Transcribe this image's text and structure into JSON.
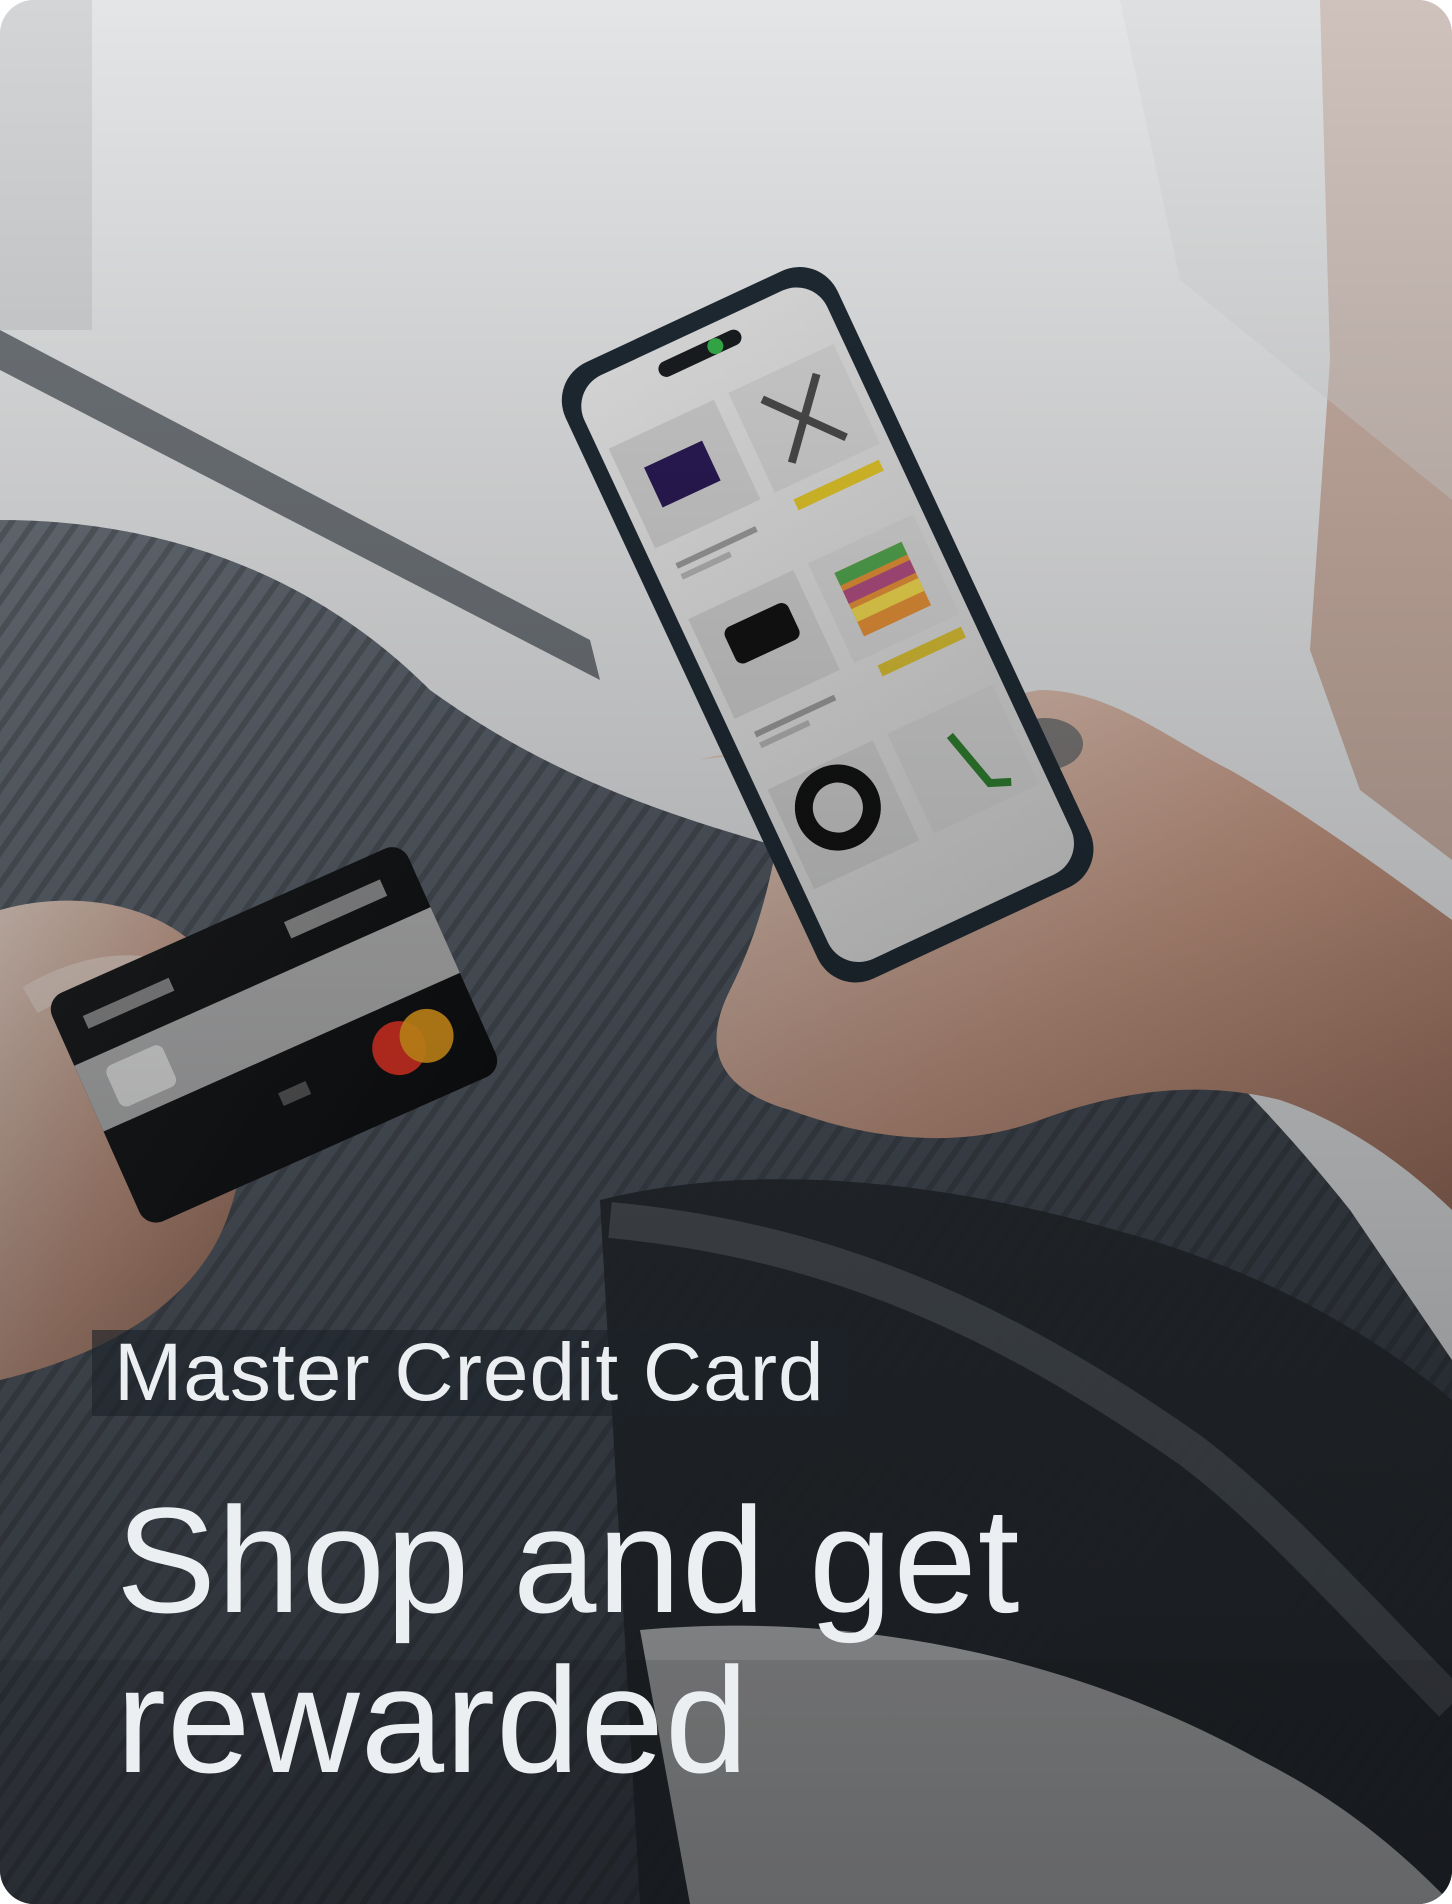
{
  "promo": {
    "eyebrow": "Master Credit Card",
    "headline": "Shop and get rewarded"
  }
}
